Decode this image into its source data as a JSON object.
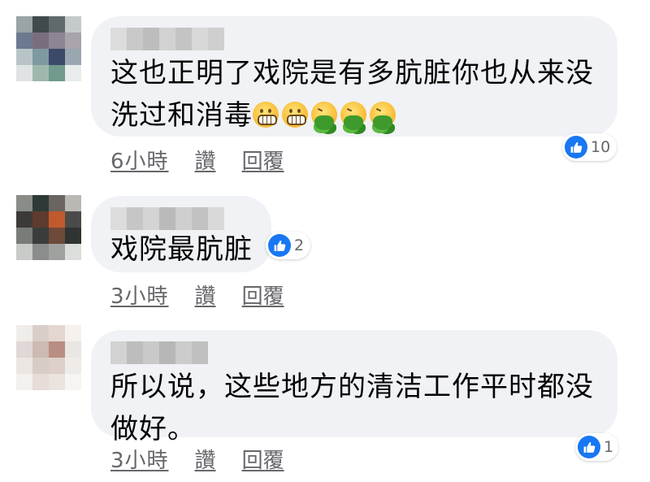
{
  "comments": [
    {
      "text_lines": [
        "这也正明了戏院是有多肮脏你也从来没",
        "洗过和消毒"
      ],
      "emojis": [
        "grimacing-face-icon",
        "grimacing-face-icon",
        "vomiting-face-icon",
        "vomiting-face-icon",
        "vomiting-face-icon"
      ],
      "reaction_count": "10",
      "time": "6小時",
      "like_label": "讚",
      "reply_label": "回覆"
    },
    {
      "text_lines": [
        "戏院最肮脏"
      ],
      "reaction_count": "2",
      "time": "3小時",
      "like_label": "讚",
      "reply_label": "回覆"
    },
    {
      "text_lines": [
        "所以说，这些地方的清洁工作平时都没",
        "做好。"
      ],
      "reaction_count": "1",
      "time": "3小時",
      "like_label": "讚",
      "reply_label": "回覆"
    }
  ],
  "colors": {
    "bubble": "#f0f2f5",
    "like_blue": "#1877f2",
    "meta_text": "#65676b"
  }
}
